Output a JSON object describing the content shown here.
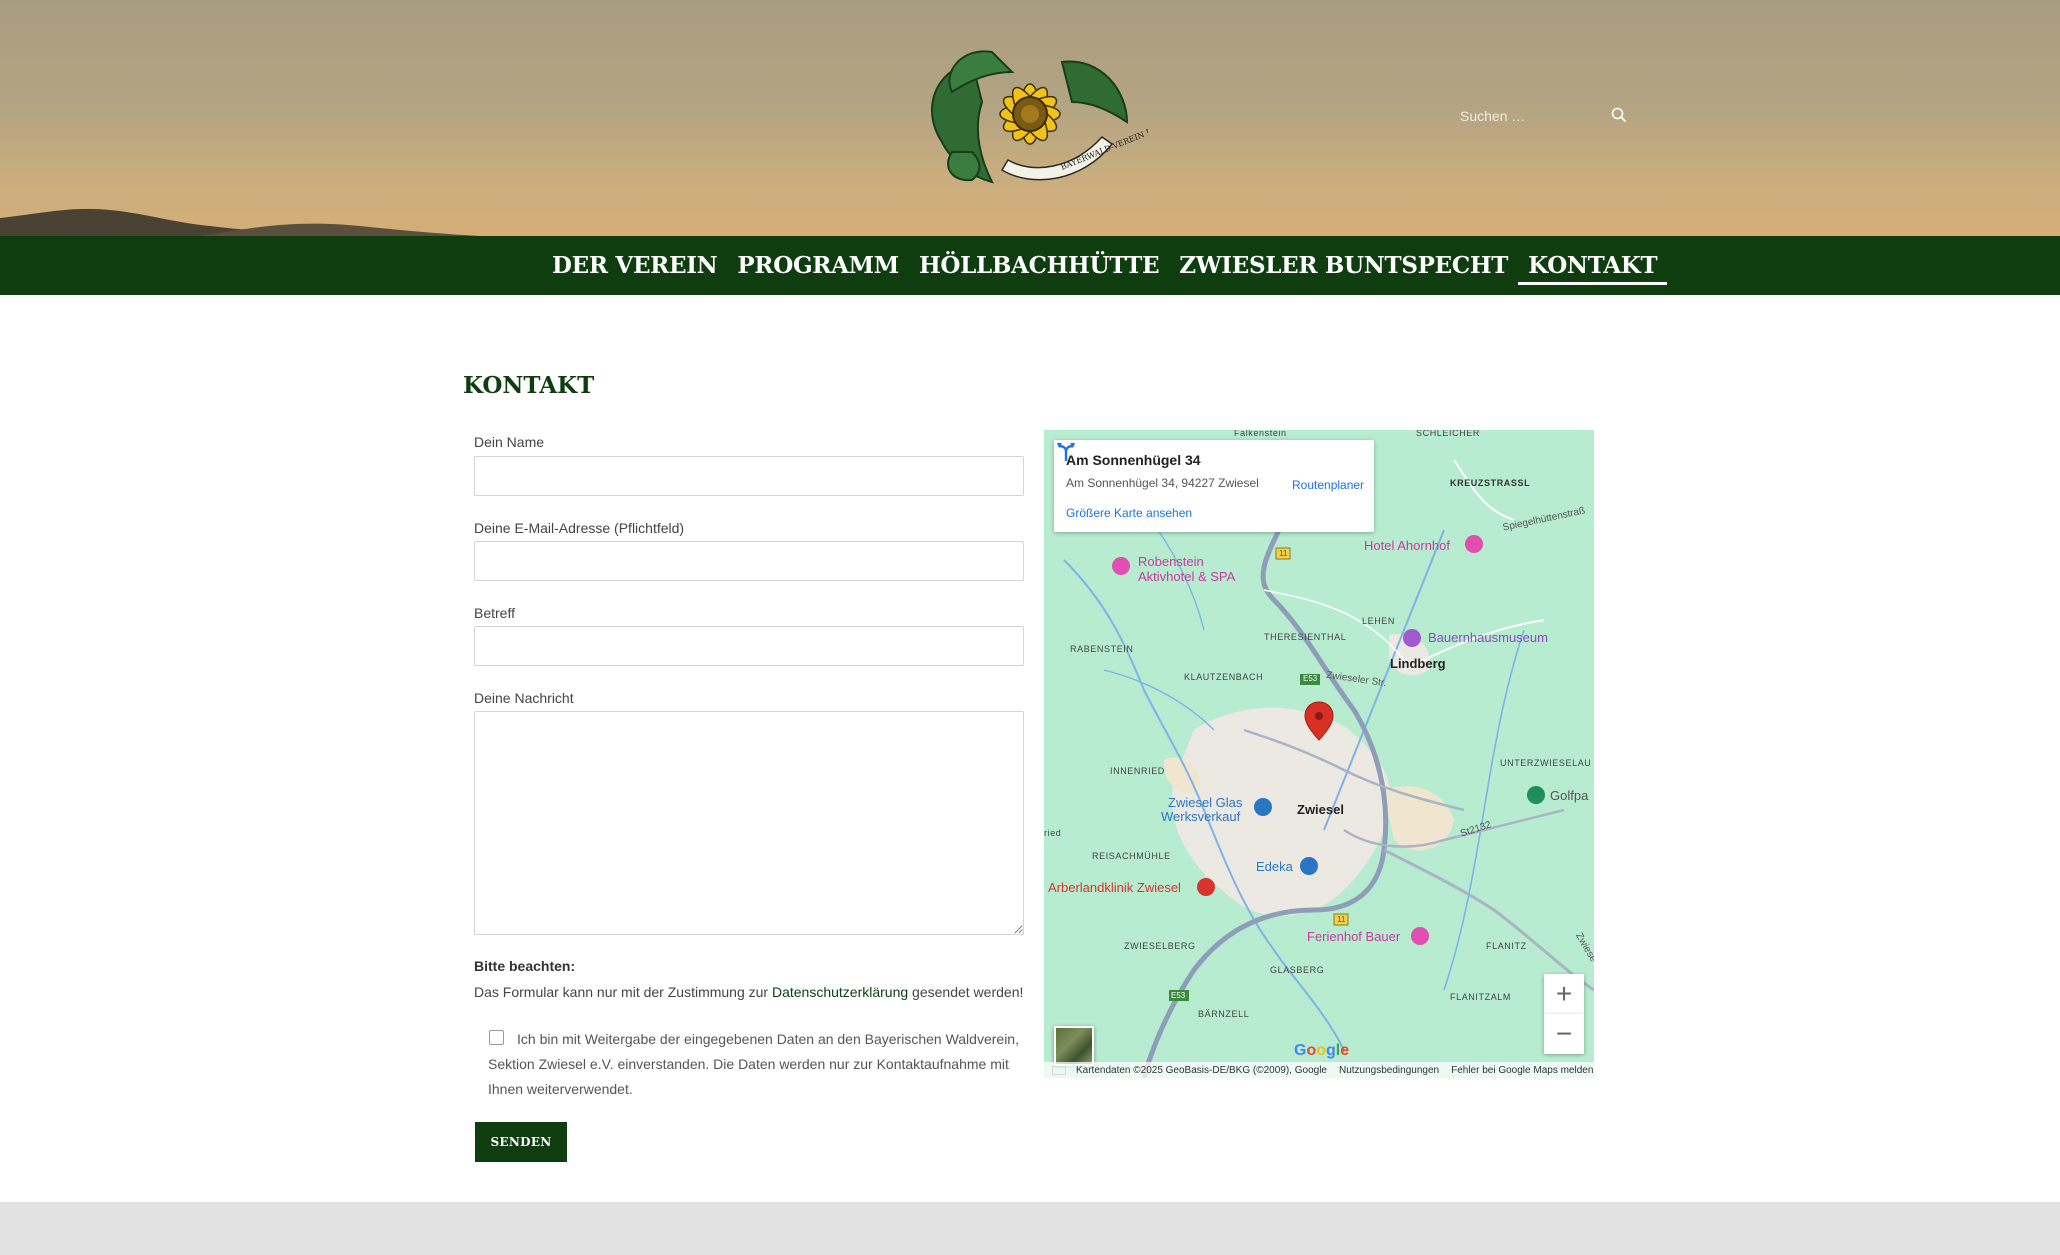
{
  "header": {
    "logo_text": "BAYERWALD-VEREIN E.V.",
    "search_placeholder": "Suchen …"
  },
  "nav": {
    "items": [
      {
        "label": "DER VEREIN"
      },
      {
        "label": "PROGRAMM"
      },
      {
        "label": "HÖLLBACHHÜTTE"
      },
      {
        "label": "ZWIESLER BUNTSPECHT"
      },
      {
        "label": "KONTAKT",
        "active": true
      }
    ]
  },
  "main": {
    "title": "KONTAKT",
    "form": {
      "name_label": "Dein Name",
      "email_label": "Deine E-Mail-Adresse (Pflichtfeld)",
      "subject_label": "Betreff",
      "message_label": "Deine Nachricht",
      "note_title": "Bitte beachten:",
      "note_text_before": "Das Formular kann nur mit der Zustimmung zur ",
      "note_link": "Datenschutzerklärung",
      "note_text_after": " gesendet werden!",
      "consent_text": "Ich bin mit Weitergabe der eingegebenen Daten an den Bayerischen Waldverein, Sektion Zwiesel e.V. einverstanden. Die Daten werden nur zur Kontaktaufnahme mit Ihnen weiterverwendet.",
      "consent_checked": false,
      "send_label": "SENDEN"
    }
  },
  "map": {
    "card_title": "Am Sonnenhügel 34",
    "card_address": "Am Sonnenhügel 34, 94227 Zwiesel",
    "route_label": "Routenplaner",
    "larger_map_link": "Größere Karte ansehen",
    "labels": {
      "schleicher": "SCHLEICHER",
      "kreuzstrassl": "KREUZSTRASSL",
      "spiegelhuetten": "Spiegelhüttenstraß",
      "hotel_ahornhof": "Hotel Ahornhof",
      "robenstein_1": "Robenstein",
      "robenstein_2": "Aktivhotel & SPA",
      "lehen": "LEHEN",
      "bauernhausmuseum": "Bauernhausmuseum",
      "theresienthal": "THERESIENTHAL",
      "rabenstein": "RABENSTEIN",
      "lindberg": "Lindberg",
      "klautzenbach": "KLAUTZENBACH",
      "e53_a": "E53",
      "zwieseler_str": "Zwieseler Str.",
      "innenried": "INNENRIED",
      "unterzwieselau": "UNTERZWIESELAU",
      "golfpa": "Golfpa",
      "zwiesel_glas_1": "Zwiesel Glas",
      "zwiesel_glas_2": "Werksverkauf",
      "zwiesel": "Zwiesel",
      "st2132": "St2132",
      "ried": "ried",
      "reisachmuehle": "REISACHMÜHLE",
      "edeka": "Edeka",
      "arberlandklinik": "Arberlandklinik Zwiesel",
      "b11_a": "11",
      "b11_b": "11",
      "ferienhof": "Ferienhof Bauer",
      "zwieselberg": "ZWIESELBERG",
      "flanitz": "FLANITZ",
      "zwiese": "Zwiese",
      "glasberg": "GLASBERG",
      "e53_b": "E53",
      "flanitzalm": "FLANITZALM",
      "baernzell": "BÄRNZELL",
      "falkenstein": "Falkenstein"
    },
    "google_logo": "Google",
    "attribution": {
      "data": "Kartendaten ©2025 GeoBasis-DE/BKG (©2009), Google",
      "terms": "Nutzungsbedingungen",
      "report": "Fehler bei Google Maps melden"
    },
    "colors": {
      "land": "#b7ecd0",
      "urban": "#ece9e2",
      "water": "#7fb3e8",
      "highway": "#8f9eb8",
      "marker": "#d93025"
    }
  }
}
